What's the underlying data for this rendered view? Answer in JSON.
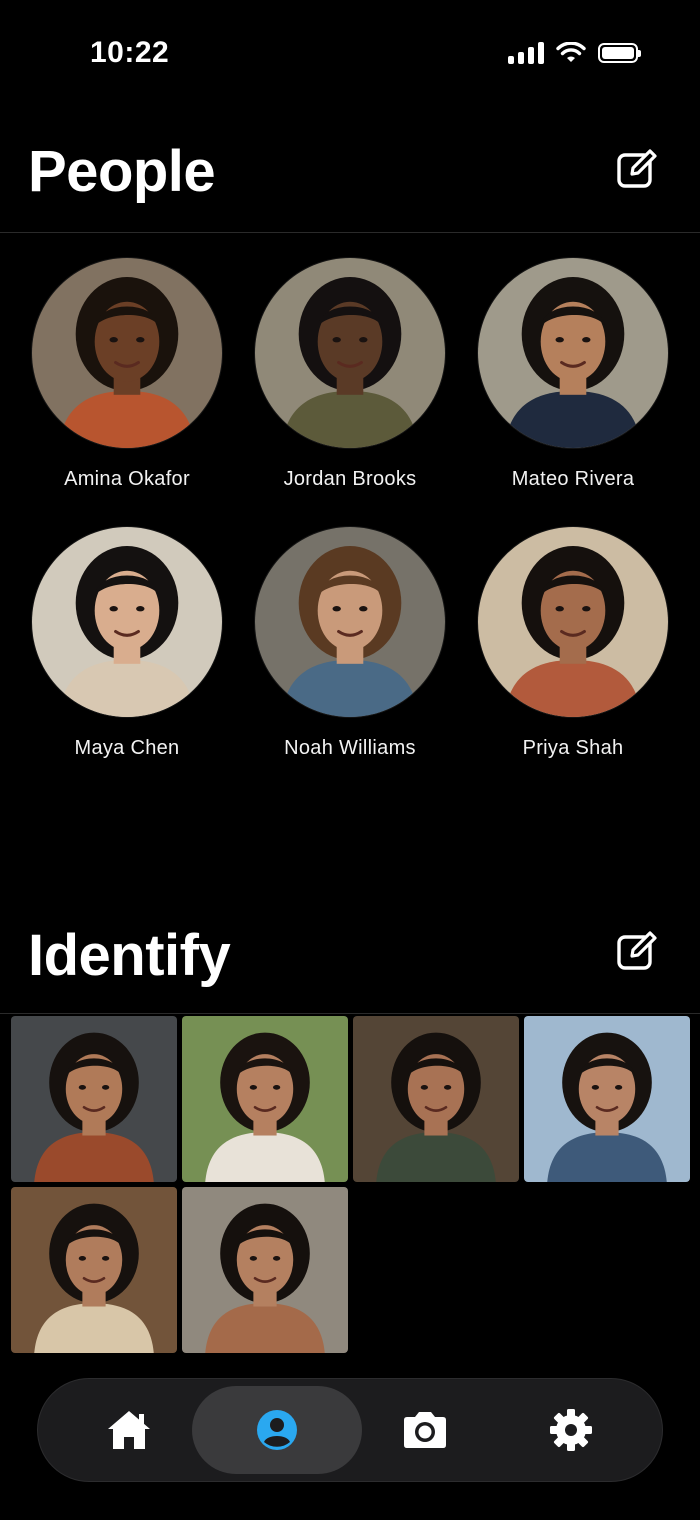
{
  "status_bar": {
    "time": "10:22",
    "icons": [
      "cellular-signal-icon",
      "wifi-icon",
      "battery-icon"
    ]
  },
  "people_section": {
    "title": "People",
    "edit_icon": "edit-square-icon",
    "people": [
      {
        "name": "Amina Okafor",
        "bg": "#7a6a58",
        "skin": "#6b3f26",
        "hair": "#1a120c",
        "shirt": "#b8552f"
      },
      {
        "name": "Jordan Brooks",
        "bg": "#8a8270",
        "skin": "#5a3a26",
        "hair": "#141010",
        "shirt": "#5c5a3a"
      },
      {
        "name": "Mateo Rivera",
        "bg": "#9a9484",
        "skin": "#b5805c",
        "hair": "#15110e",
        "shirt": "#1f2a3e"
      },
      {
        "name": "Maya Chen",
        "bg": "#cfc7b8",
        "skin": "#d9ad8e",
        "hair": "#141110",
        "shirt": "#d8c8b2"
      },
      {
        "name": "Noah Williams",
        "bg": "#6e6a60",
        "skin": "#c99a7a",
        "hair": "#5a3a22",
        "shirt": "#4a6a86"
      },
      {
        "name": "Priya Shah",
        "bg": "#c9b89e",
        "skin": "#a46c4c",
        "hair": "#15100d",
        "shirt": "#b25a3c"
      }
    ]
  },
  "identify_section": {
    "title": "Identify",
    "edit_icon": "edit-square-icon",
    "photos": [
      {
        "bg": "#3a3d40",
        "skin": "#b07a58",
        "hair": "#16110e",
        "shirt": "#9a4a2c"
      },
      {
        "bg": "#6e8a4a",
        "skin": "#b58060",
        "hair": "#1a130f",
        "shirt": "#e8e2d8"
      },
      {
        "bg": "#4a3a2a",
        "skin": "#a87254",
        "hair": "#15100d",
        "shirt": "#3c4a3a"
      },
      {
        "bg": "#9ab4cc",
        "skin": "#b88466",
        "hair": "#17120f",
        "shirt": "#3e5a7a"
      },
      {
        "bg": "#6a4a2e",
        "skin": "#b07c5c",
        "hair": "#16110e",
        "shirt": "#d8c6a8"
      },
      {
        "bg": "#8a8276",
        "skin": "#b48060",
        "hair": "#15100d",
        "shirt": "#a46a4a"
      }
    ]
  },
  "tab_bar": {
    "tabs": [
      {
        "icon": "home-icon",
        "active": false
      },
      {
        "icon": "person-circle-icon",
        "active": true
      },
      {
        "icon": "camera-icon",
        "active": false
      },
      {
        "icon": "gear-icon",
        "active": false
      }
    ],
    "active_color": "#2aa8f0"
  }
}
